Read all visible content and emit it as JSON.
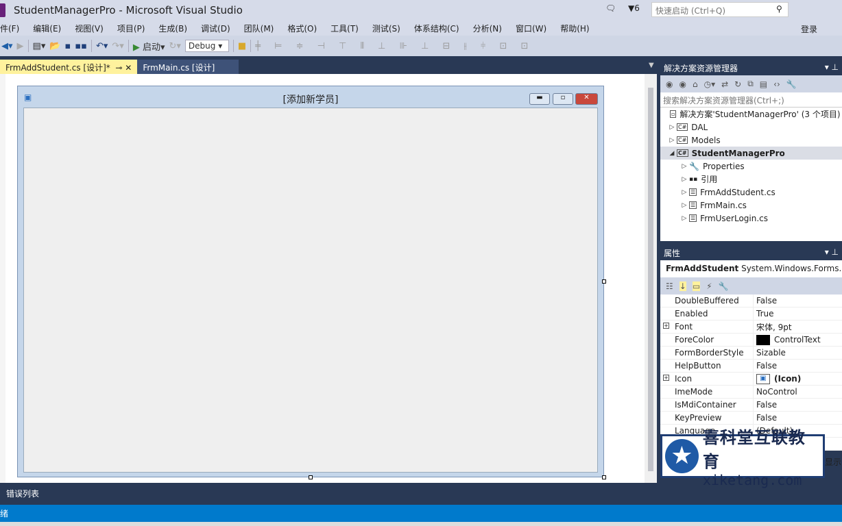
{
  "window": {
    "title": "StudentManagerPro - Microsoft Visual Studio",
    "notifications": "6",
    "quick_launch_placeholder": "快速启动 (Ctrl+Q)",
    "login": "登录"
  },
  "menu": [
    "件(F)",
    "编辑(E)",
    "视图(V)",
    "项目(P)",
    "生成(B)",
    "调试(D)",
    "团队(M)",
    "格式(O)",
    "工具(T)",
    "测试(S)",
    "体系结构(C)",
    "分析(N)",
    "窗口(W)",
    "帮助(H)"
  ],
  "toolbar": {
    "start_label": "启动",
    "config": "Debug"
  },
  "tabs": [
    {
      "label": "FrmAddStudent.cs [设计]*",
      "active": true
    },
    {
      "label": "FrmMain.cs [设计]",
      "active": false
    }
  ],
  "form": {
    "caption": "[添加新学员]"
  },
  "solution_explorer": {
    "title": "解决方案资源管理器",
    "search_placeholder": "搜索解决方案资源管理器(Ctrl+;)",
    "items": [
      {
        "label": "解决方案'StudentManagerPro' (3 个项目)",
        "level": 0
      },
      {
        "label": "DAL",
        "level": 1
      },
      {
        "label": "Models",
        "level": 1
      },
      {
        "label": "StudentManagerPro",
        "level": 1,
        "selected": true,
        "expanded": true
      },
      {
        "label": "Properties",
        "level": 2
      },
      {
        "label": "引用",
        "level": 2
      },
      {
        "label": "FrmAddStudent.cs",
        "level": 2
      },
      {
        "label": "FrmMain.cs",
        "level": 2
      },
      {
        "label": "FrmUserLogin.cs",
        "level": 2
      }
    ]
  },
  "properties": {
    "title": "属性",
    "object_name": "FrmAddStudent",
    "object_type": "System.Windows.Forms.Fo",
    "rows": [
      {
        "name": "DoubleBuffered",
        "value": "False"
      },
      {
        "name": "Enabled",
        "value": "True"
      },
      {
        "name": "Font",
        "value": "宋体, 9pt",
        "expandable": true
      },
      {
        "name": "ForeColor",
        "value": "ControlText",
        "swatch": "#000000"
      },
      {
        "name": "FormBorderStyle",
        "value": "Sizable"
      },
      {
        "name": "HelpButton",
        "value": "False"
      },
      {
        "name": "Icon",
        "value": "(Icon)",
        "expandable": true,
        "bold": true
      },
      {
        "name": "ImeMode",
        "value": "NoControl"
      },
      {
        "name": "IsMdiContainer",
        "value": "False"
      },
      {
        "name": "KeyPreview",
        "value": "False"
      },
      {
        "name": "Language",
        "value": "(Default)"
      }
    ],
    "partial_text": "显示"
  },
  "watermark": {
    "cn": "喜科堂互联教育",
    "en": "xiketang.com"
  },
  "error_list": "错误列表",
  "status": "绪",
  "colors": {
    "accent": "#007acc",
    "navy": "#293955",
    "active_tab": "#fff29d"
  }
}
